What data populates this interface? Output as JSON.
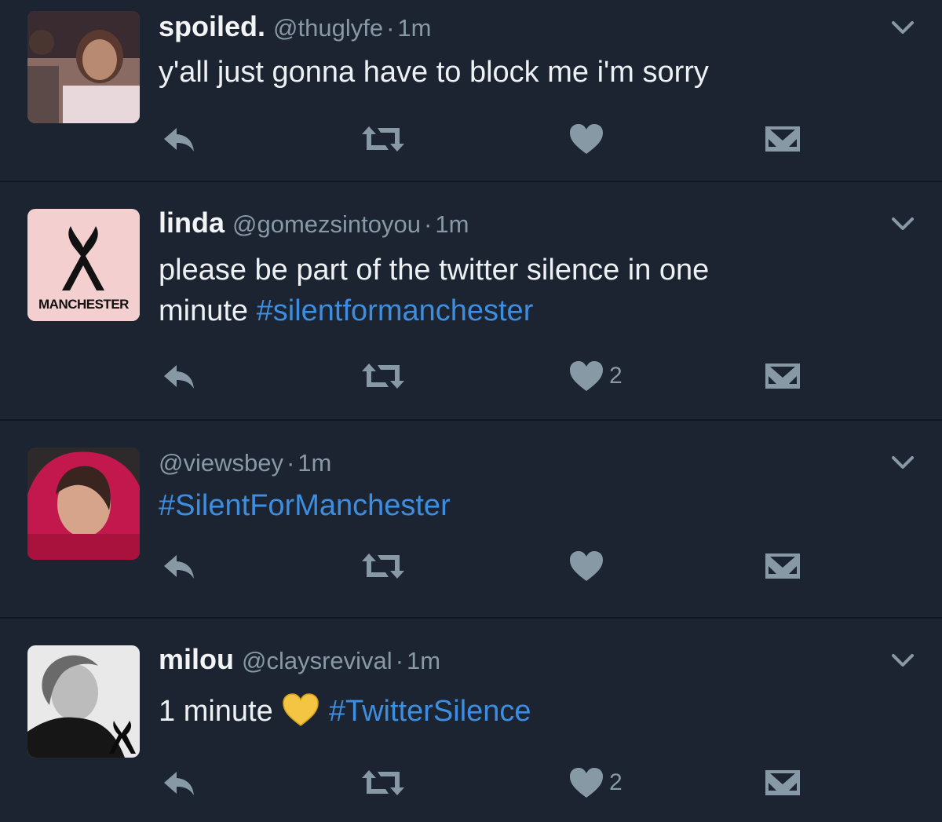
{
  "colors": {
    "background": "#1b2430",
    "divider": "#111820",
    "text": "#eef1f4",
    "secondary": "#8899a6",
    "hashtag": "#3d8ee0",
    "action_icon": "#8899a6"
  },
  "tweets": [
    {
      "name": "spoiled.",
      "handle": "@thuglyfe",
      "sep": "·",
      "time": "1m",
      "text_parts": [
        "y'all just gonna have to block me i'm sorry"
      ],
      "likes": ""
    },
    {
      "name": "linda",
      "handle": "@gomezsintoyou",
      "sep": "·",
      "time": "1m",
      "text_parts": [
        "please be part of the twitter silence in one",
        "minute ",
        "#silentformanchester"
      ],
      "avatar_text": "MANCHESTER",
      "likes": "2"
    },
    {
      "name": "",
      "handle": "@viewsbey",
      "sep": "·",
      "time": "1m",
      "text_parts": [
        "#SilentForManchester"
      ],
      "likes": ""
    },
    {
      "name": "milou",
      "handle": "@claysrevival",
      "sep": "·",
      "time": "1m",
      "text_parts": [
        "1 minute ",
        "💛",
        " #TwitterSilence"
      ],
      "likes": "2"
    }
  ],
  "icons": {
    "reply": "reply-icon",
    "retweet": "retweet-icon",
    "like": "heart-icon",
    "dm": "direct-message-icon",
    "caret": "chevron-down-icon"
  }
}
